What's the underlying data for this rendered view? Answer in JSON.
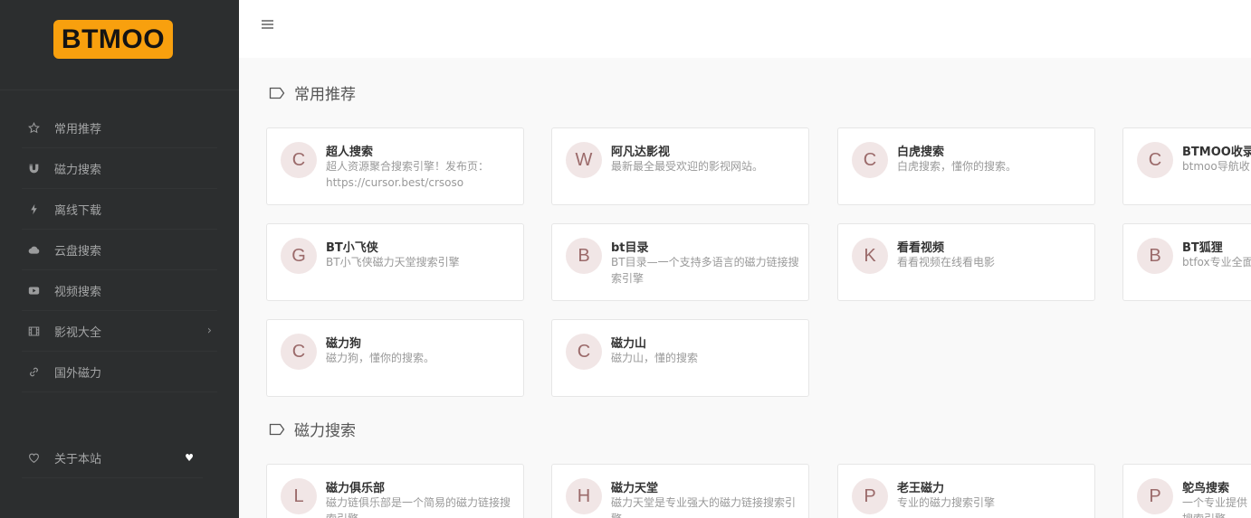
{
  "brand": {
    "logo_text": "BTMOO",
    "accent": "#f8a00e"
  },
  "sidebar": {
    "items": [
      {
        "label": "常用推荐",
        "icon": "star-icon"
      },
      {
        "label": "磁力搜索",
        "icon": "magnet-icon"
      },
      {
        "label": "离线下载",
        "icon": "bolt-icon"
      },
      {
        "label": "云盘搜索",
        "icon": "cloud-icon"
      },
      {
        "label": "视频搜索",
        "icon": "youtube-icon"
      },
      {
        "label": "影视大全",
        "icon": "film-icon",
        "has_submenu": true
      },
      {
        "label": "国外磁力",
        "icon": "link-icon"
      }
    ],
    "about": {
      "label": "关于本站",
      "icon": "heart-icon",
      "trail_icon": "heart-filled-icon"
    }
  },
  "topbar": {
    "menu_icon": "hamburger-icon"
  },
  "sections": [
    {
      "title": "常用推荐",
      "cards": [
        {
          "avatar": "C",
          "name": "超人搜索",
          "desc": "超人资源聚合搜索引擎！发布页：https://cursor.best/crsoso"
        },
        {
          "avatar": "W",
          "name": "阿凡达影视",
          "desc": "最新最全最受欢迎的影视网站。"
        },
        {
          "avatar": "C",
          "name": "白虎搜索",
          "desc": "白虎搜索，懂你的搜索。"
        },
        {
          "avatar": "C",
          "name": "BTMOO收录",
          "desc": "btmoo导航收"
        },
        {
          "avatar": "G",
          "name": "BT小飞侠",
          "desc": "BT小飞侠磁力天堂搜索引擎"
        },
        {
          "avatar": "B",
          "name": "bt目录",
          "desc": "BT目录—一个支持多语言的磁力链接搜索引擎"
        },
        {
          "avatar": "K",
          "name": "看看视频",
          "desc": "看看视频在线看电影"
        },
        {
          "avatar": "B",
          "name": "BT狐狸",
          "desc": "btfox专业全面"
        },
        {
          "avatar": "C",
          "name": "磁力狗",
          "desc": "磁力狗，懂你的搜索。"
        },
        {
          "avatar": "C",
          "name": "磁力山",
          "desc": "磁力山，懂的搜索"
        }
      ]
    },
    {
      "title": "磁力搜索",
      "cards": [
        {
          "avatar": "L",
          "name": "磁力俱乐部",
          "desc": "磁力链俱乐部是一个简易的磁力链接搜索引擎"
        },
        {
          "avatar": "H",
          "name": "磁力天堂",
          "desc": "磁力天堂是专业强大的磁力链接搜索引擎"
        },
        {
          "avatar": "P",
          "name": "老王磁力",
          "desc": "专业的磁力搜索引擎"
        },
        {
          "avatar": "P",
          "name": "鸵鸟搜索",
          "desc": "一个专业提供搜索引擎"
        }
      ]
    }
  ]
}
